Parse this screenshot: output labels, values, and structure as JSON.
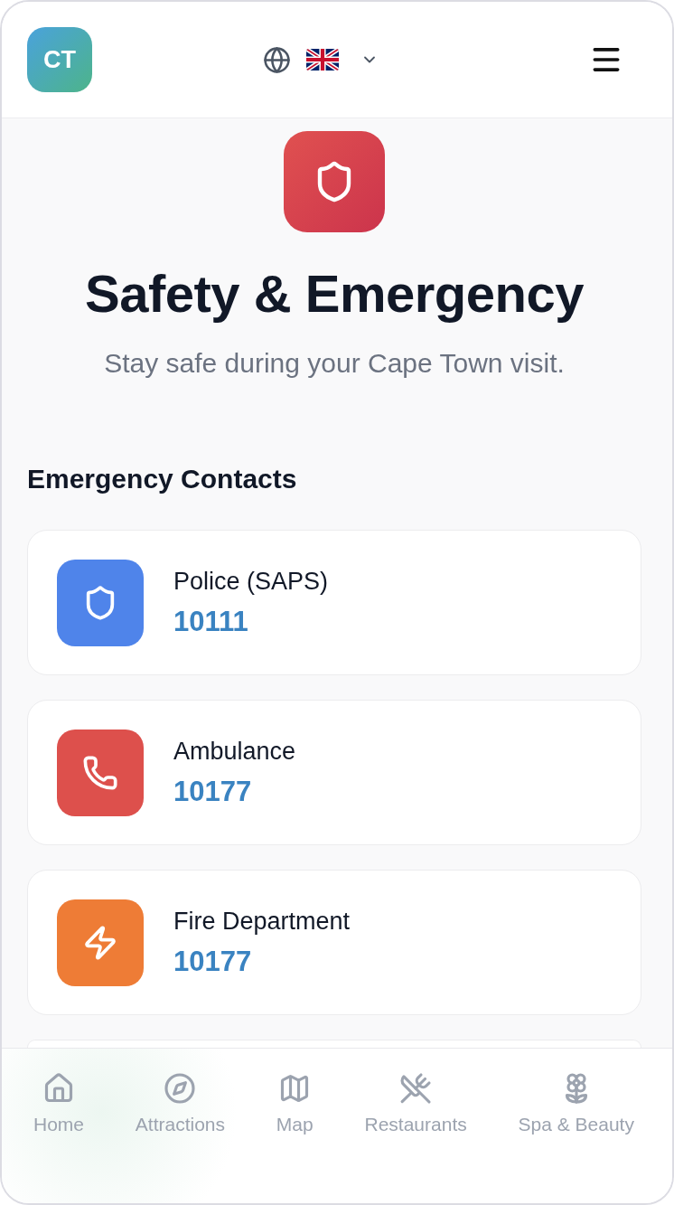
{
  "header": {
    "logo": "CT"
  },
  "hero": {
    "title": "Safety & Emergency",
    "subtitle": "Stay safe during your Cape Town visit."
  },
  "emergency_contacts": {
    "heading": "Emergency Contacts",
    "items": [
      {
        "name": "Police (SAPS)",
        "number": "10111",
        "color": "#4f84ea"
      },
      {
        "name": "Ambulance",
        "number": "10177",
        "color": "#dd504c"
      },
      {
        "name": "Fire Department",
        "number": "10177",
        "color": "#ee7c36"
      }
    ]
  },
  "bottom_nav": [
    {
      "label": "Home",
      "selected": false
    },
    {
      "label": "Attractions",
      "selected": false
    },
    {
      "label": "Map",
      "selected": false
    },
    {
      "label": "Restaurants",
      "selected": false
    },
    {
      "label": "Spa & Beauty",
      "selected": false
    }
  ]
}
